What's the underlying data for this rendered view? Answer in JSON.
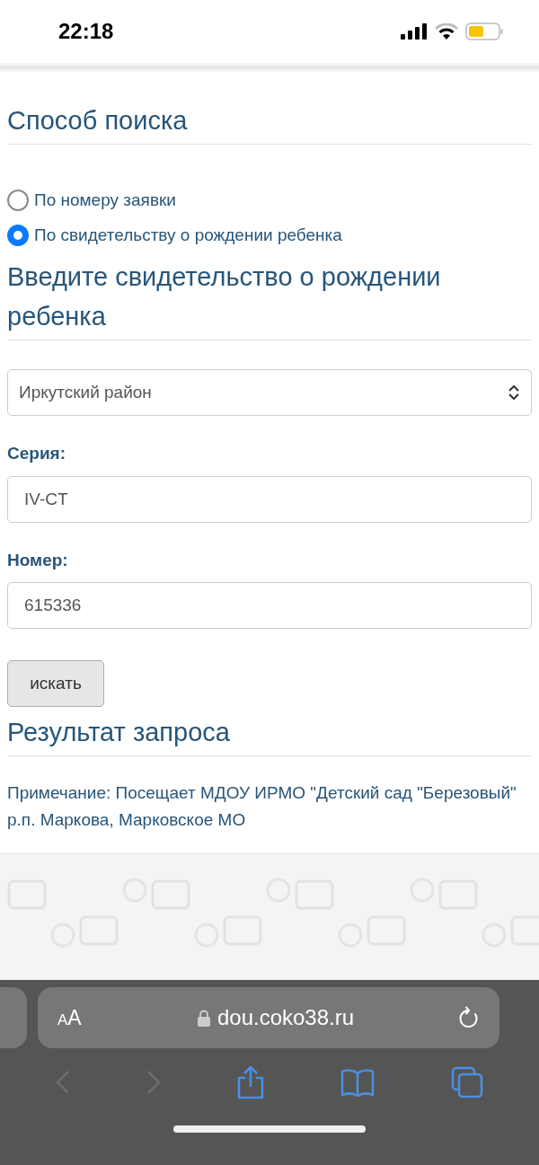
{
  "status_bar": {
    "time": "22:18"
  },
  "search_method": {
    "title": "Способ поиска",
    "options": [
      {
        "label": "По номеру заявки",
        "selected": false
      },
      {
        "label": "По свидетельству о рождении ребенка",
        "selected": true
      }
    ]
  },
  "certificate": {
    "title": "Введите свидетельство о рождении ребенка",
    "district": "Иркутский район",
    "fields": [
      {
        "label": "Серия:",
        "value": "IV-CT"
      },
      {
        "label": "Номер:",
        "value": "615336"
      }
    ],
    "submit": "искать"
  },
  "result": {
    "title": "Результат запроса",
    "note": "Примечание: Посещает МДОУ ИРМО \"Детский сад \"Березовый\" р.п. Маркова, Марковское МО"
  },
  "browser": {
    "text_size": "AA",
    "url": "dou.coko38.ru"
  }
}
